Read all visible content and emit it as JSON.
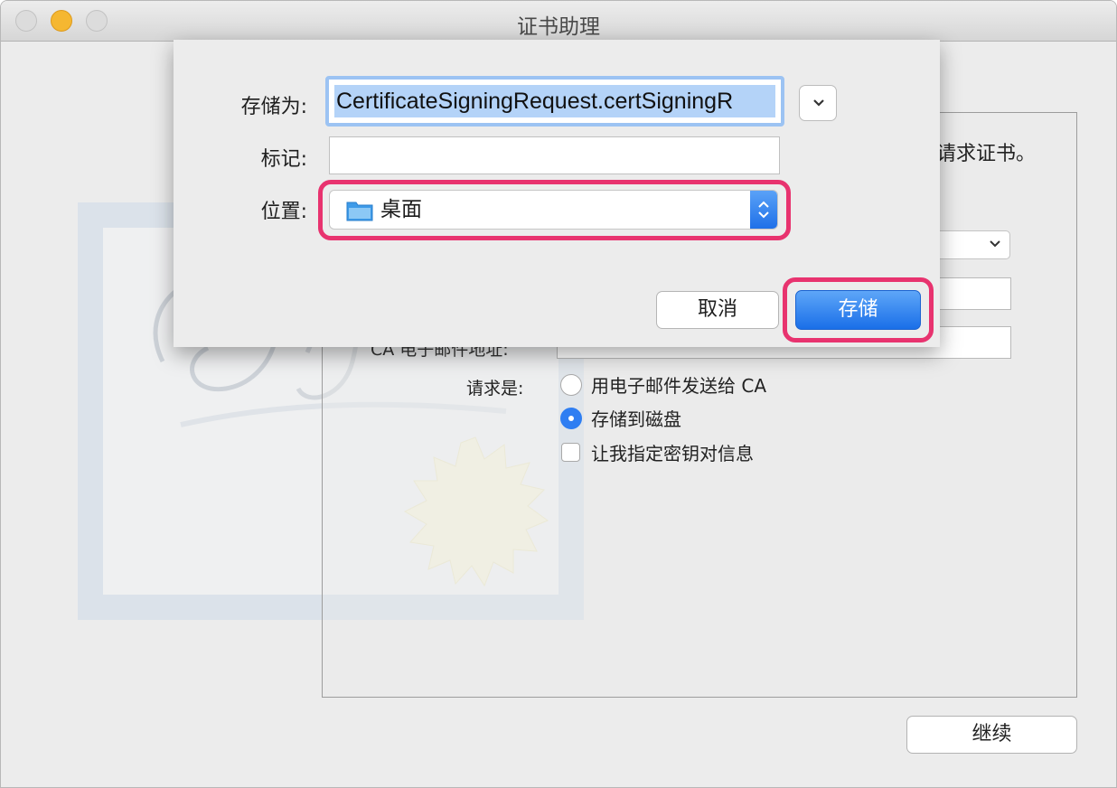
{
  "window": {
    "title": "证书助理"
  },
  "background": {
    "heading_fragment": "请求证书。",
    "email_label_partial": "CA 电子邮件地址:",
    "request_label": "请求是:",
    "options": [
      {
        "label": "用电子邮件发送给 CA",
        "selected": false
      },
      {
        "label": "存储到磁盘",
        "selected": true
      }
    ],
    "checkbox": {
      "label": "让我指定密钥对信息",
      "checked": false
    },
    "continue_label": "继续"
  },
  "save_sheet": {
    "save_as_label": "存储为:",
    "filename_value": "CertificateSigningRequest.certSigningR",
    "tags_label": "标记:",
    "tags_value": "",
    "location_label": "位置:",
    "location_value": "桌面",
    "cancel_label": "取消",
    "save_label": "存储"
  },
  "colors": {
    "accent": "#2f7ef2",
    "highlight": "#e8336f",
    "selection": "#b4d3f8"
  }
}
